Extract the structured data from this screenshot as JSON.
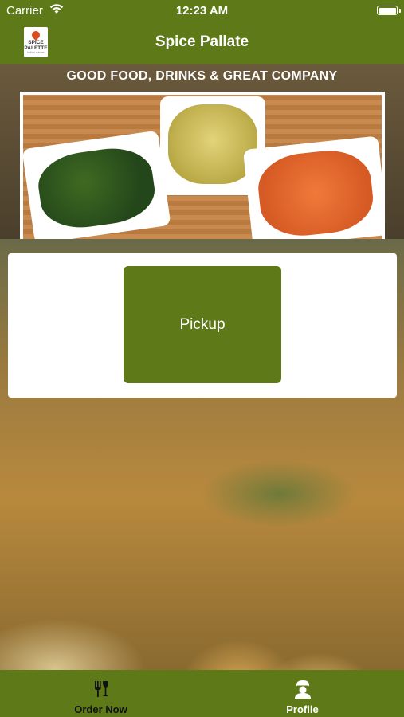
{
  "status_bar": {
    "carrier": "Carrier",
    "time": "12:23 AM"
  },
  "nav": {
    "title": "Spice Pallate",
    "logo_text": "SPICE PALETTE",
    "logo_subtitle": "indian cuisine"
  },
  "hero": {
    "tagline": "GOOD FOOD, DRINKS & GREAT COMPANY"
  },
  "main": {
    "pickup_label": "Pickup"
  },
  "tab_bar": {
    "items": [
      {
        "label": "Order Now",
        "icon": "fork-wine-glass-icon",
        "active": false
      },
      {
        "label": "Profile",
        "icon": "chef-profile-icon",
        "active": true
      }
    ]
  },
  "colors": {
    "brand_green": "#5e7a18",
    "card_background": "#ffffff"
  }
}
